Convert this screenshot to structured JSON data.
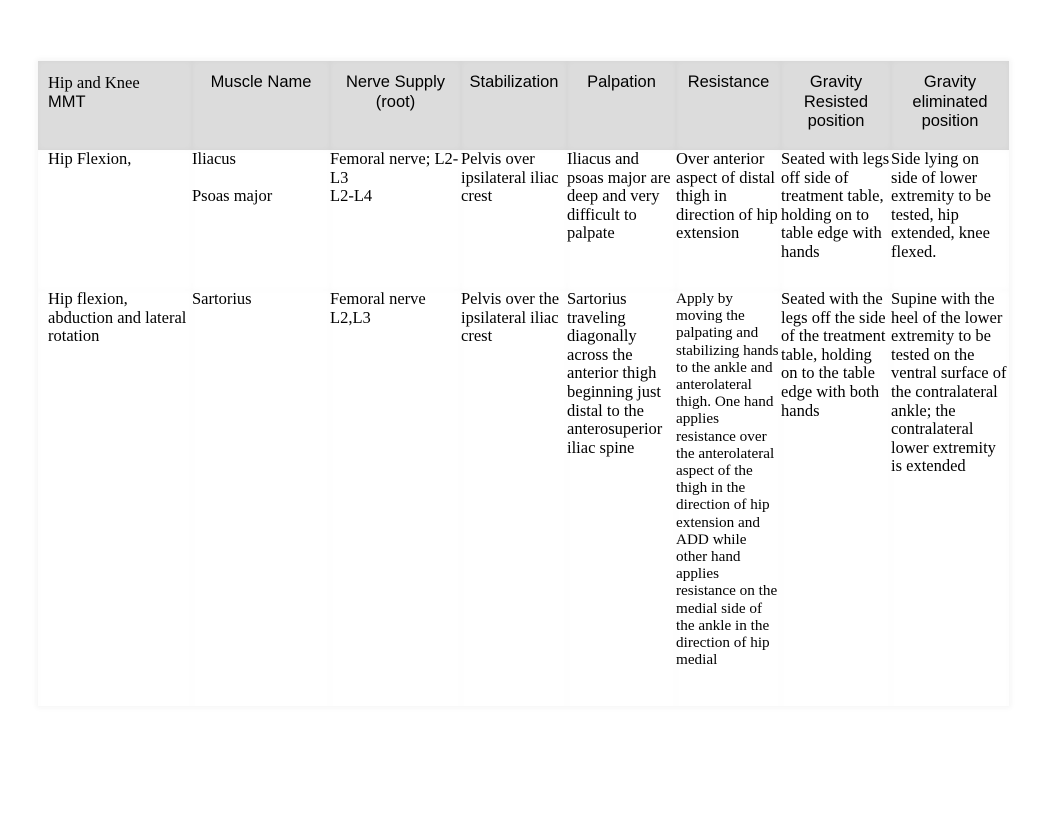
{
  "document": {
    "title": "Hip and Knee MMT",
    "background_color": "#ffffff",
    "header_background_color": "#dcdcdc",
    "text_color": "#000000"
  },
  "table": {
    "headers": [
      {
        "line1": "Hip and Knee",
        "line2": "MMT",
        "name": "hip-and-knee-mmt"
      },
      {
        "line1": "Muscle Name",
        "line2": "",
        "name": "muscle-name"
      },
      {
        "line1": "Nerve Supply",
        "line2": "(root)",
        "name": "nerve-supply-root"
      },
      {
        "line1": "Stabilization",
        "line2": "",
        "name": "stabilization"
      },
      {
        "line1": "Palpation",
        "line2": "",
        "name": "palpation"
      },
      {
        "line1": "Resistance",
        "line2": "",
        "name": "resistance"
      },
      {
        "line1": "Gravity",
        "line2": "Resisted position",
        "name": "gravity-resisted-position"
      },
      {
        "line1": "Gravity",
        "line2": "eliminated position",
        "name": "gravity-eliminated-position"
      }
    ],
    "rows": [
      {
        "name": "row-hip-flexion",
        "movement": "Hip Flexion,",
        "muscle_name_1": "Iliacus",
        "muscle_name_2": "Psoas major",
        "nerve_supply_1": "Femoral nerve; L2-L3",
        "nerve_supply_2": "L2-L4",
        "stabilization": "Pelvis over ipsilateral iliac crest",
        "palpation": "Iliacus and psoas major are deep and very difficult to palpate",
        "resistance": "Over anterior aspect of distal thigh in direction of hip extension",
        "gravity_resisted": "Seated with legs off side of treatment table, holding on to table edge with hands",
        "gravity_eliminated": "Side lying on side of lower extremity to be tested, hip extended, knee flexed."
      },
      {
        "name": "row-hip-flexion-abduction-lateral-rotation",
        "movement": "Hip flexion, abduction and lateral rotation",
        "muscle_name_1": "Sartorius",
        "muscle_name_2": "",
        "nerve_supply_1": "Femoral nerve",
        "nerve_supply_2": "L2,L3",
        "stabilization": "Pelvis over the ipsilateral iliac crest",
        "palpation": "Sartorius traveling diagonally across the anterior thigh beginning just distal to the anterosuperior iliac spine",
        "resistance": "Apply by moving the palpating and stabilizing hands to the ankle and anterolateral thigh. One hand applies resistance over the anterolateral aspect of the thigh in the direction of hip extension and ADD while other hand applies resistance on the medial side of the ankle in the direction of hip medial",
        "gravity_resisted": "Seated with the legs off the side of the treatment table, holding on to the table edge with both hands",
        "gravity_eliminated": "Supine with the heel of the lower extremity to be tested on the ventral surface of the contralateral ankle; the contralateral lower extremity is extended"
      }
    ]
  }
}
